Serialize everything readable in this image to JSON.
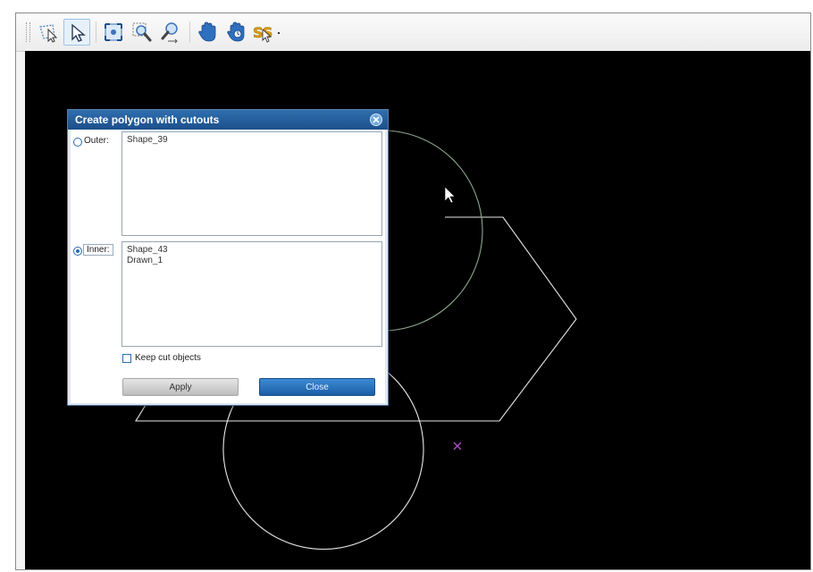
{
  "toolbar": {
    "tools": [
      {
        "name": "lasso-select-icon",
        "active": false
      },
      {
        "name": "select-arrow-icon",
        "active": true
      },
      {
        "name": "zoom-extents-icon",
        "active": false
      },
      {
        "name": "zoom-window-icon",
        "active": false
      },
      {
        "name": "zoom-realtime-icon",
        "active": false
      },
      {
        "name": "pan-hand-icon",
        "active": false
      },
      {
        "name": "pan-hand-rotate-icon",
        "active": false
      },
      {
        "name": "snap-settings-icon",
        "active": false
      }
    ]
  },
  "dialog": {
    "title": "Create polygon with cutouts",
    "outer_label": "Outer:",
    "inner_label": "Inner:",
    "selected_group": "inner",
    "outer_items": [
      "Shape_39"
    ],
    "inner_items": [
      "Shape_43",
      "Drawn_1"
    ],
    "keep_cut_objects_label": "Keep cut objects",
    "keep_cut_objects_checked": false,
    "apply_label": "Apply",
    "close_label": "Close"
  },
  "colors": {
    "canvas_bg": "#000000",
    "shape_stroke": "#e8e8e8",
    "selected_circle": "#8fa88f",
    "snap_marker": "#b04cc4",
    "accent": "#1c4f8a"
  }
}
